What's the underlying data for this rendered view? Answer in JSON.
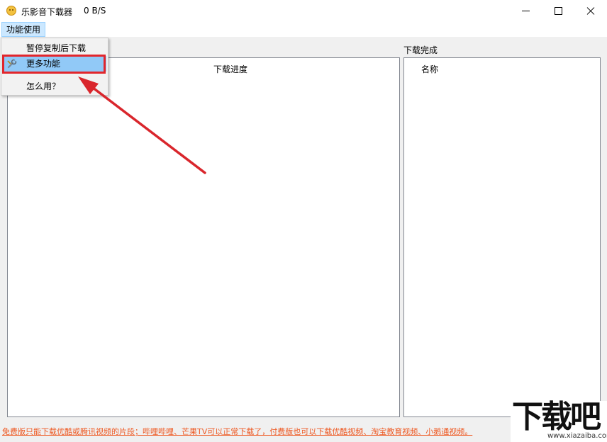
{
  "window": {
    "title": "乐影音下载器",
    "speed": "0 B/S"
  },
  "menubar": {
    "function_menu": "功能使用"
  },
  "dropdown": {
    "items": [
      {
        "label": "暂停复制后下载"
      },
      {
        "label": "更多功能",
        "icon": "tools-icon"
      },
      {
        "label": "怎么用？"
      }
    ]
  },
  "panels": {
    "done_label": "下载完成",
    "left_header": "下载进度",
    "right_header": "名称"
  },
  "footer": {
    "notice": "免费版只能下载优酷或腾讯视频的片段；哔哩哔哩、芒果TV可以正常下载了，付费版也可以下载优酷视频、淘宝教育视频、小鹅通视频。"
  },
  "watermark": {
    "logo_text": "下载吧",
    "url": "www.xiazaiba.com"
  },
  "colors": {
    "highlight": "#e2262c",
    "footer_text": "#ee5a24",
    "selected_item": "#91c9f7"
  }
}
